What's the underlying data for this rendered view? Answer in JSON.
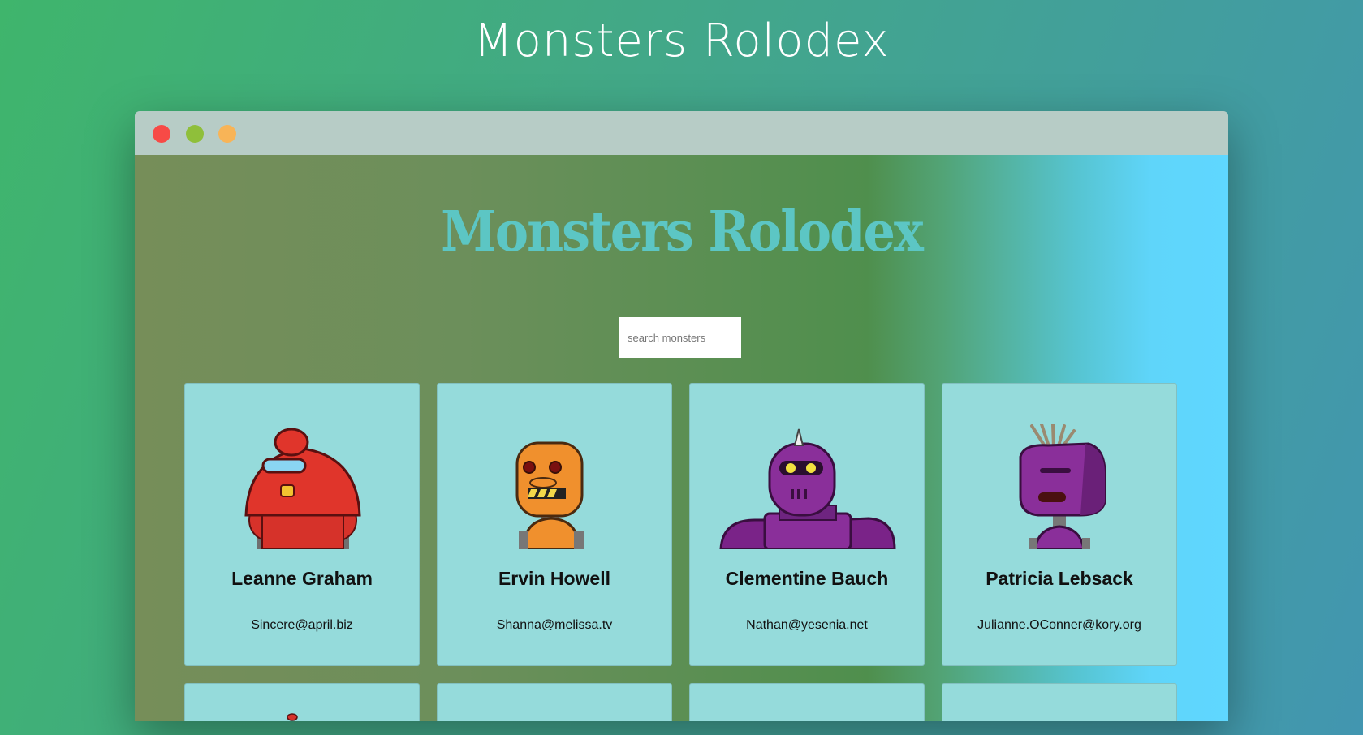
{
  "page_title": "Monsters Rolodex",
  "app": {
    "title": "Monsters Rolodex",
    "search": {
      "placeholder": "search monsters",
      "value": ""
    }
  },
  "monsters": [
    {
      "name": "Leanne Graham",
      "email": "Sincere@april.biz",
      "color": "#e0352b"
    },
    {
      "name": "Ervin Howell",
      "email": "Shanna@melissa.tv",
      "color": "#f0902d"
    },
    {
      "name": "Clementine Bauch",
      "email": "Nathan@yesenia.net",
      "color": "#8a2f9a"
    },
    {
      "name": "Patricia Lebsack",
      "email": "Julianne.OConner@kory.org",
      "color": "#8a2f9a"
    }
  ],
  "window_controls": {
    "close": "#f74a46",
    "minimize": "#8fbf3a",
    "maximize": "#f8b457"
  }
}
